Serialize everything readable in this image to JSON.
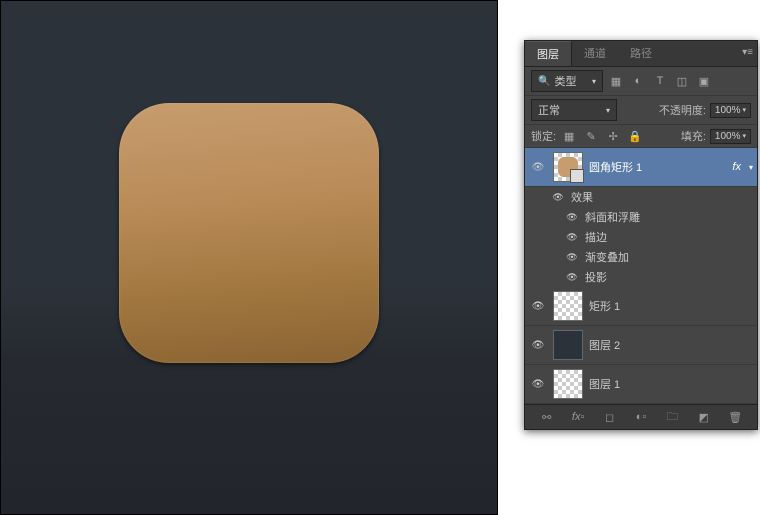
{
  "tabs": {
    "layers": "图层",
    "channels": "通道",
    "paths": "路径"
  },
  "filter": {
    "kind": "类型"
  },
  "blend": {
    "mode": "正常",
    "opacity_label": "不透明度:",
    "opacity": "100%"
  },
  "lock": {
    "label": "锁定:",
    "fill_label": "填充:",
    "fill": "100%"
  },
  "layers": {
    "rounded": {
      "name": "圆角矩形 1",
      "fx": "fx",
      "effects_label": "效果",
      "effects": {
        "bevel": "斜面和浮雕",
        "stroke": "描边",
        "gradient": "渐变叠加",
        "shadow": "投影"
      }
    },
    "rect": {
      "name": "矩形 1"
    },
    "layer2": {
      "name": "图层 2"
    },
    "layer1": {
      "name": "图层 1"
    }
  }
}
